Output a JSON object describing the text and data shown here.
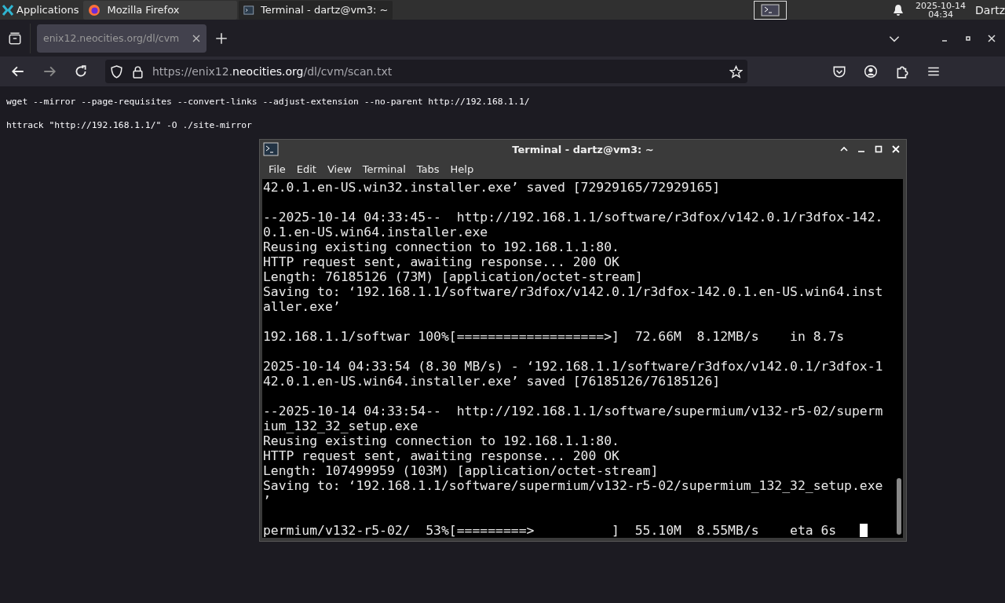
{
  "taskbar": {
    "apps_label": "Applications",
    "windows": [
      {
        "title": "Mozilla Firefox",
        "kind": "browser",
        "selected": false
      },
      {
        "title": "Terminal - dartz@vm3: ~",
        "kind": "terminal",
        "selected": true
      }
    ],
    "clock_date": "2025-10-14",
    "clock_time": "04:34",
    "user": "Dartz"
  },
  "browser": {
    "tabs": [
      {
        "title": "enix12.neocities.org/dl/cvm",
        "selected": true
      }
    ],
    "url": {
      "prefix": "https://enix12.",
      "domain": "neocities.org",
      "path": "/dl/cvm/scan.txt"
    },
    "page_lines": [
      "wget --mirror --page-requisites --convert-links --adjust-extension --no-parent http://192.168.1.1/",
      "httrack \"http://192.168.1.1/\" -O ./site-mirror"
    ]
  },
  "terminal": {
    "title": "Terminal - dartz@vm3: ~",
    "menu": [
      "File",
      "Edit",
      "View",
      "Terminal",
      "Tabs",
      "Help"
    ],
    "blocks": [
      [
        "42.0.1.en-US.win32.installer.exe’ saved [72929165/72929165]"
      ],
      [
        "--2025-10-14 04:33:45--  http://192.168.1.1/software/r3dfox/v142.0.1/r3dfox-142.",
        "0.1.en-US.win64.installer.exe",
        "Reusing existing connection to 192.168.1.1:80.",
        "HTTP request sent, awaiting response... 200 OK",
        "Length: 76185126 (73M) [application/octet-stream]",
        "Saving to: ‘192.168.1.1/software/r3dfox/v142.0.1/r3dfox-142.0.1.en-US.win64.inst",
        "aller.exe’"
      ],
      [
        "192.168.1.1/softwar 100%[===================>]  72.66M  8.12MB/s    in 8.7s"
      ],
      [
        "2025-10-14 04:33:54 (8.30 MB/s) - ‘192.168.1.1/software/r3dfox/v142.0.1/r3dfox-1",
        "42.0.1.en-US.win64.installer.exe’ saved [76185126/76185126]"
      ],
      [
        "--2025-10-14 04:33:54--  http://192.168.1.1/software/supermium/v132-r5-02/superm",
        "ium_132_32_setup.exe",
        "Reusing existing connection to 192.168.1.1:80.",
        "HTTP request sent, awaiting response... 200 OK",
        "Length: 107499959 (103M) [application/octet-stream]",
        "Saving to: ‘192.168.1.1/software/supermium/v132-r5-02/supermium_132_32_setup.exe",
        "’"
      ],
      [
        "permium/v132-r5-02/  53%[=========>          ]  55.10M  8.55MB/s    eta 6s"
      ]
    ]
  }
}
